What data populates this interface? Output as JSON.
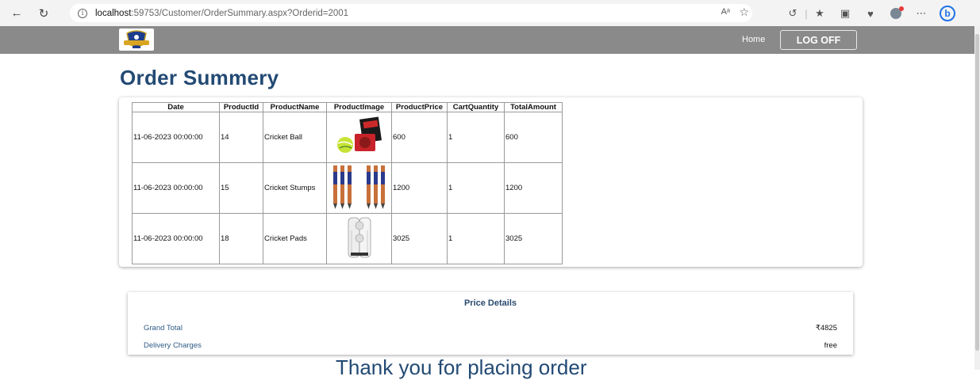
{
  "browser": {
    "url_host": "localhost",
    "url_path": ":59753/Customer/OrderSummary.aspx?Orderid=2001",
    "read_aloud_icon_text": "Aᵃ"
  },
  "header": {
    "home_label": "Home",
    "logoff_label": "LOG OFF"
  },
  "page": {
    "title": "Order Summery",
    "thank_you": "Thank you for placing order"
  },
  "orders_table": {
    "columns": [
      "Date",
      "ProductId",
      "ProductName",
      "ProductImage",
      "ProductPrice",
      "CartQuantity",
      "TotalAmount"
    ],
    "rows": [
      {
        "date": "11-06-2023 00:00:00",
        "product_id": "14",
        "product_name": "Cricket Ball",
        "image": "cricket-ball-image",
        "price": "600",
        "quantity": "1",
        "total": "600"
      },
      {
        "date": "11-06-2023 00:00:00",
        "product_id": "15",
        "product_name": "Cricket Stumps",
        "image": "cricket-stumps-image",
        "price": "1200",
        "quantity": "1",
        "total": "1200"
      },
      {
        "date": "11-06-2023 00:00:00",
        "product_id": "18",
        "product_name": "Cricket Pads",
        "image": "cricket-pads-image",
        "price": "3025",
        "quantity": "1",
        "total": "3025"
      }
    ]
  },
  "price_details": {
    "title": "Price Details",
    "grand_total_label": "Grand Total",
    "grand_total_value": "₹4825",
    "delivery_label": "Delivery Charges",
    "delivery_value": "free"
  },
  "colors": {
    "header_bg": "#8a8a8a",
    "title_blue": "#234a74",
    "label_blue": "#2f5a86"
  }
}
